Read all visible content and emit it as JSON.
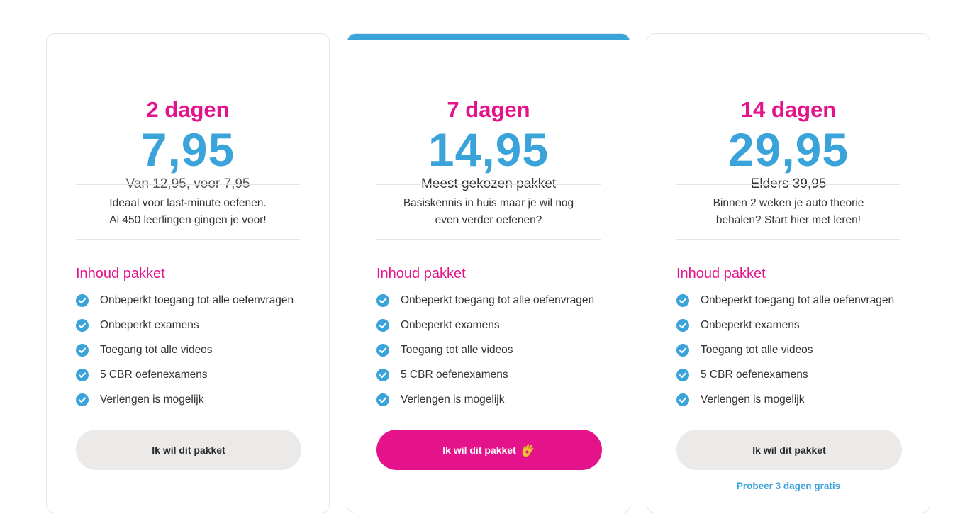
{
  "colors": {
    "accent_pink": "#e5138b",
    "accent_blue": "#3aa3d9",
    "button_gray": "#eceae8"
  },
  "feature_icon": "check-circle-icon",
  "plans": [
    {
      "days": "2 dagen",
      "price": "7,95",
      "subtext": "Van 12,95, voor 7,95",
      "description": [
        "Ideaal voor last-minute oefenen.",
        "Al 450 leerlingen gingen je voor!"
      ],
      "heading": "Inhoud pakket",
      "features": [
        "Onbeperkt toegang tot alle oefenvragen",
        "Onbeperkt examens",
        "Toegang tot alle videos",
        "5 CBR oefenexamens",
        "Verlengen is mogelijk"
      ],
      "button_label": "Ik wil dit pakket"
    },
    {
      "days": "7 dagen",
      "price": "14,95",
      "subtext": "Meest gekozen pakket",
      "description": [
        "Basiskennis in huis maar je wil nog",
        "even verder oefenen?"
      ],
      "heading": "Inhoud pakket",
      "features": [
        "Onbeperkt toegang tot alle oefenvragen",
        "Onbeperkt examens",
        "Toegang tot alle videos",
        "5 CBR oefenexamens",
        "Verlengen is mogelijk"
      ],
      "button_label": "Ik wil dit pakket",
      "button_icon": "ok-hand-icon"
    },
    {
      "days": "14 dagen",
      "price": "29,95",
      "subtext": "Elders 39,95",
      "description": [
        "Binnen 2 weken je auto theorie",
        "behalen? Start hier met leren!"
      ],
      "heading": "Inhoud pakket",
      "features": [
        "Onbeperkt toegang tot alle oefenvragen",
        "Onbeperkt examens",
        "Toegang tot alle videos",
        "5 CBR oefenexamens",
        "Verlengen is mogelijk"
      ],
      "button_label": "Ik wil dit pakket",
      "trial_link": "Probeer 3 dagen gratis"
    }
  ]
}
